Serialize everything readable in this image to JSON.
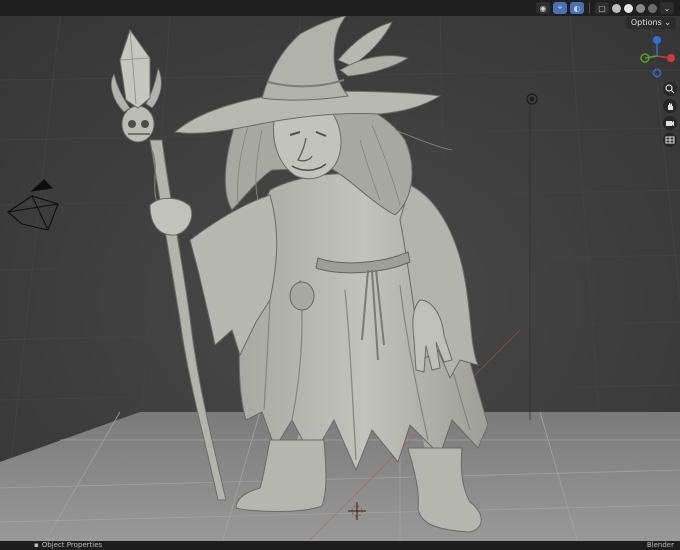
{
  "header": {
    "options_label": "Options ⌄"
  },
  "viewport": {
    "object": "witch character sculpt"
  },
  "status_bar": {
    "left_label": "Object Properties",
    "right_label": "Blender"
  },
  "colors": {
    "background": "#3d3d3d",
    "floor": "#8a8a8a",
    "model": "#b9b9b4",
    "gizmo_z": "#2d6fd3",
    "gizmo_x": "#d23b3b",
    "gizmo_y": "#5aa02c"
  }
}
